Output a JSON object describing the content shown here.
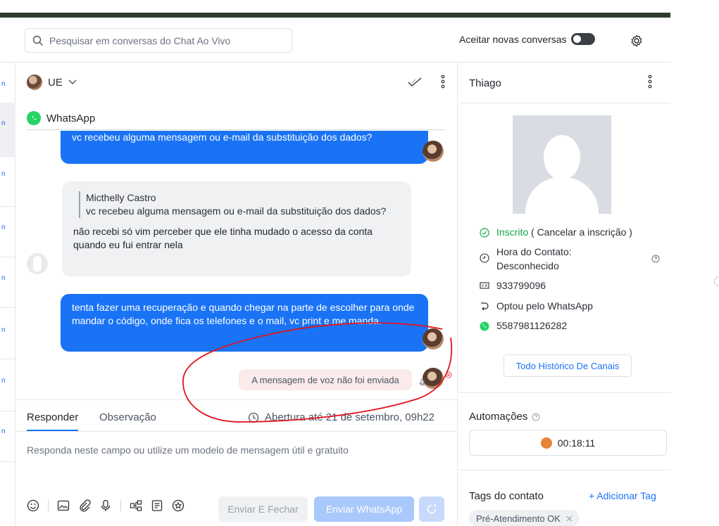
{
  "header": {
    "search_placeholder": "Pesquisar em conversas do Chat Ao Vivo",
    "accept_label": "Aceitar novas conversas",
    "accept_enabled": false
  },
  "left_strip": {
    "letters": [
      "n",
      "n",
      "n",
      "n",
      "n",
      "n",
      "n",
      "n"
    ]
  },
  "chat": {
    "contact_short": "UE",
    "channel_label": "WhatsApp",
    "messages": {
      "m1": "vc recebeu alguma mensagem ou e-mail da substituição dos dados?",
      "m2_quote_author": "Micthelly Castro",
      "m2_quote_text": "vc recebeu alguma mensagem ou e-mail da substituição dos dados?",
      "m2_text": "não recebi só vim perceber que ele tinha mudado o acesso da conta quando eu fui entrar nela",
      "m3": "tenta fazer uma recuperação e quando chegar na parte de escolher para onde mandar o código, onde fica os telefones e o mail, vc print e me manda.",
      "voice_error": "A mensagem de voz não foi enviada"
    },
    "tabs": {
      "reply": "Responder",
      "note": "Observação"
    },
    "abertura": "Abertura até 21 de setembro, 09h22",
    "composer_placeholder": "Responda neste campo ou utilize um modelo de mensagem útil e gratuito",
    "buttons": {
      "send_close": "Enviar E Fechar",
      "send_whatsapp": "Enviar WhatsApp"
    }
  },
  "contact": {
    "name": "Thiago",
    "subscribed_label": "Inscrito",
    "unsubscribe_text": "( Cancelar a inscrição )",
    "contact_hour_label": "Hora do Contato:",
    "contact_hour_value": "Desconhecido",
    "id_value": "933799096",
    "opt_in": "Optou pelo WhatsApp",
    "whatsapp_number": "5587981126282",
    "history_button": "Todo Histórico De Canais",
    "automations_title": "Automações",
    "timer": "00:18:11",
    "tags_title": "Tags do contato",
    "add_tag": "+ Adicionar Tag",
    "tags": [
      "Pré-Atendimento OK"
    ]
  },
  "colors": {
    "accent": "#1a73f5",
    "whatsapp": "#25d366",
    "annotation": "#e0121b"
  }
}
